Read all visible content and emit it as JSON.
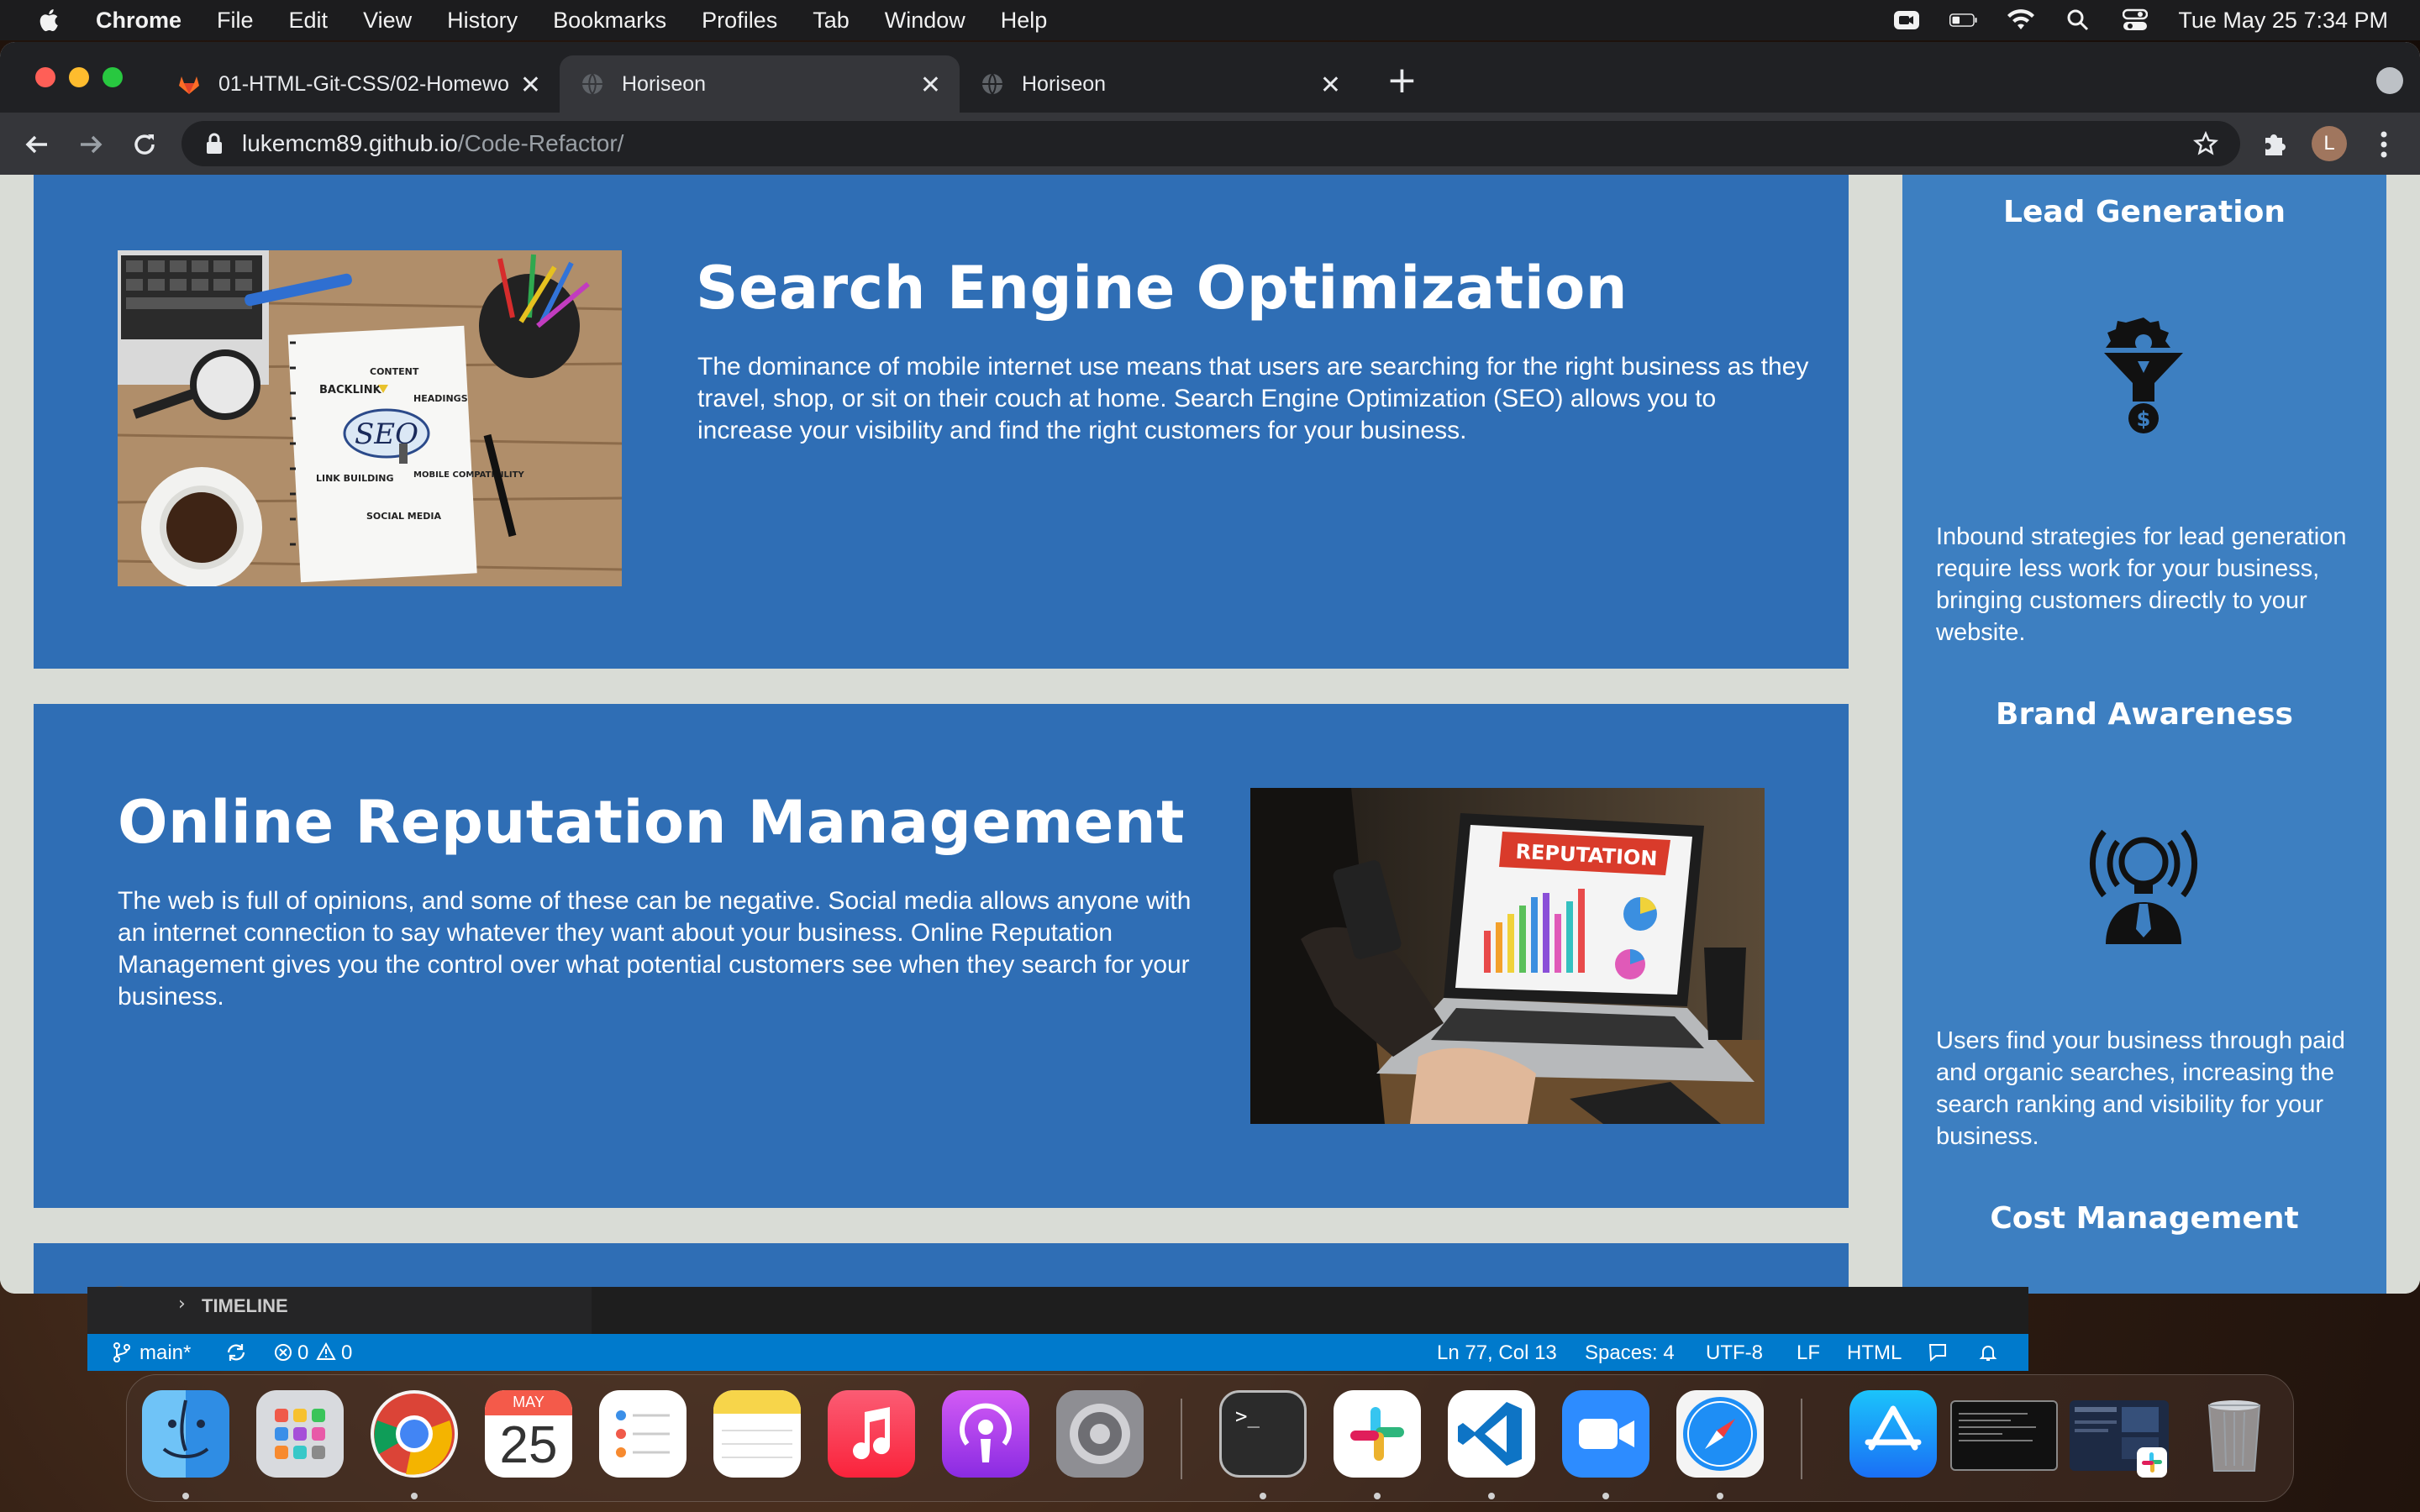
{
  "menubar": {
    "app": "Chrome",
    "items": [
      "File",
      "Edit",
      "View",
      "History",
      "Bookmarks",
      "Profiles",
      "Tab",
      "Window",
      "Help"
    ],
    "clock": "Tue May 25  7:34 PM"
  },
  "browser": {
    "tabs": [
      {
        "title": "01-HTML-Git-CSS/02-Homewo",
        "favicon": "gitlab-icon"
      },
      {
        "title": "Horiseon",
        "favicon": "globe-icon"
      },
      {
        "title": "Horiseon",
        "favicon": "globe-icon"
      }
    ],
    "active_tab": 1,
    "url_host": "lukemcm89.github.io",
    "url_path": "/Code-Refactor/",
    "profile_initial": "L"
  },
  "page": {
    "sections": [
      {
        "title": "Search Engine Optimization",
        "body": "The dominance of mobile internet use means that users are searching for the right business as they travel, shop, or sit on their couch at home. Search Engine Optimization (SEO) allows you to increase your visibility and find the right customers for your business.",
        "image_labels": {
          "center": "SEO",
          "backlink": "BACKLINK",
          "content": "CONTENT",
          "headings": "HEADINGS",
          "link": "LINK BUILDING",
          "mobile": "MOBILE COMPATIBILITY",
          "social": "SOCIAL MEDIA"
        }
      },
      {
        "title": "Online Reputation Management",
        "body": "The web is full of opinions, and some of these can be negative. Social media allows anyone with an internet connection to say whatever they want about your business. Online Reputation Management gives you the control over what potential customers see when they search for your business.",
        "image_labels": {
          "banner": "REPUTATION"
        }
      }
    ],
    "benefits": [
      {
        "title": "Lead Generation",
        "icon": "lead-funnel-icon",
        "body": "Inbound strategies for lead generation require less work for your business, bringing customers directly to your website."
      },
      {
        "title": "Brand Awareness",
        "icon": "lightbulb-person-icon",
        "body": "Users find your business through paid and organic searches, increasing the search ranking and visibility for your business."
      },
      {
        "title": "Cost Management",
        "icon": "",
        "body": ""
      }
    ]
  },
  "vscode": {
    "timeline": "TIMELINE",
    "branch": "main*",
    "problems_errors": "0",
    "problems_warnings": "0",
    "cursor": "Ln 77, Col 13",
    "spaces": "Spaces: 4",
    "encoding": "UTF-8",
    "eol": "LF",
    "language": "HTML"
  },
  "dock": {
    "calendar_month": "MAY",
    "calendar_day": "25",
    "apps": [
      "finder-icon",
      "launchpad-icon",
      "chrome-icon",
      "calendar-icon",
      "reminders-icon",
      "notes-icon",
      "music-icon",
      "podcasts-icon",
      "system-preferences-icon",
      "terminal-icon",
      "slack-icon",
      "vscode-icon",
      "zoom-icon",
      "safari-icon",
      "app-store-icon",
      "terminal-window-thumbnail",
      "browser-window-thumbnail",
      "trash-icon"
    ]
  },
  "colors": {
    "card_blue": "#2f6eb5",
    "aside_blue": "#3d7fc1",
    "page_bg": "#d9dcd6"
  }
}
